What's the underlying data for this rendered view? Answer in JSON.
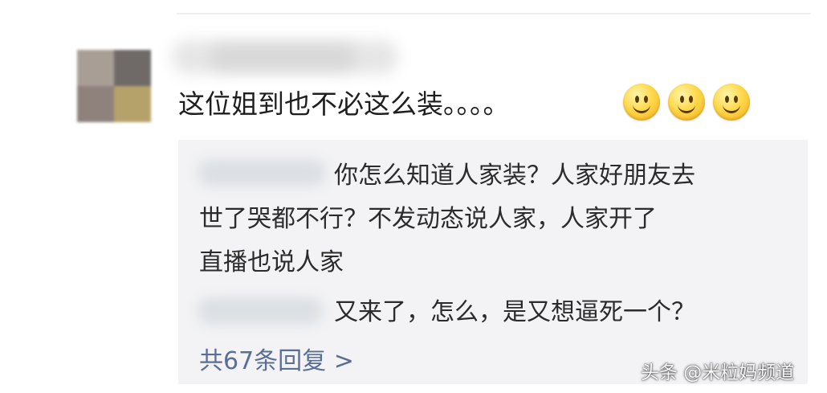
{
  "comment": {
    "text": "这位姐到也不必这么装。。。。",
    "emojis": [
      "smiley-icon",
      "smiley-icon",
      "smiley-icon"
    ]
  },
  "replies": [
    {
      "lines": [
        "你怎么知道人家装？人家好朋友去",
        "世了哭都不行？不发动态说人家，人家开了",
        "直播也说人家"
      ]
    },
    {
      "lines": [
        "又来了，怎么，是又想逼死一个？"
      ]
    }
  ],
  "more_replies": {
    "label": "共67条回复 >"
  },
  "watermark": {
    "text": "头条 @米粒妈频道"
  },
  "colors": {
    "reply_bg": "#f3f3f5",
    "link": "#5b6f94",
    "text": "#1e1e1e"
  }
}
